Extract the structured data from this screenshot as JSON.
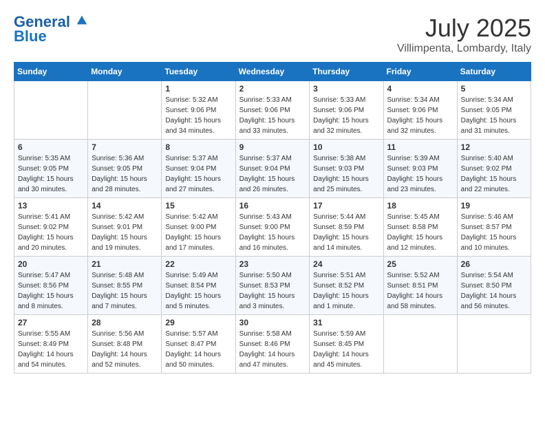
{
  "logo": {
    "line1": "General",
    "line2": "Blue"
  },
  "title": "July 2025",
  "location": "Villimpenta, Lombardy, Italy",
  "weekdays": [
    "Sunday",
    "Monday",
    "Tuesday",
    "Wednesday",
    "Thursday",
    "Friday",
    "Saturday"
  ],
  "weeks": [
    [
      {
        "day": "",
        "info": ""
      },
      {
        "day": "",
        "info": ""
      },
      {
        "day": "1",
        "info": "Sunrise: 5:32 AM\nSunset: 9:06 PM\nDaylight: 15 hours\nand 34 minutes."
      },
      {
        "day": "2",
        "info": "Sunrise: 5:33 AM\nSunset: 9:06 PM\nDaylight: 15 hours\nand 33 minutes."
      },
      {
        "day": "3",
        "info": "Sunrise: 5:33 AM\nSunset: 9:06 PM\nDaylight: 15 hours\nand 32 minutes."
      },
      {
        "day": "4",
        "info": "Sunrise: 5:34 AM\nSunset: 9:06 PM\nDaylight: 15 hours\nand 32 minutes."
      },
      {
        "day": "5",
        "info": "Sunrise: 5:34 AM\nSunset: 9:05 PM\nDaylight: 15 hours\nand 31 minutes."
      }
    ],
    [
      {
        "day": "6",
        "info": "Sunrise: 5:35 AM\nSunset: 9:05 PM\nDaylight: 15 hours\nand 30 minutes."
      },
      {
        "day": "7",
        "info": "Sunrise: 5:36 AM\nSunset: 9:05 PM\nDaylight: 15 hours\nand 28 minutes."
      },
      {
        "day": "8",
        "info": "Sunrise: 5:37 AM\nSunset: 9:04 PM\nDaylight: 15 hours\nand 27 minutes."
      },
      {
        "day": "9",
        "info": "Sunrise: 5:37 AM\nSunset: 9:04 PM\nDaylight: 15 hours\nand 26 minutes."
      },
      {
        "day": "10",
        "info": "Sunrise: 5:38 AM\nSunset: 9:03 PM\nDaylight: 15 hours\nand 25 minutes."
      },
      {
        "day": "11",
        "info": "Sunrise: 5:39 AM\nSunset: 9:03 PM\nDaylight: 15 hours\nand 23 minutes."
      },
      {
        "day": "12",
        "info": "Sunrise: 5:40 AM\nSunset: 9:02 PM\nDaylight: 15 hours\nand 22 minutes."
      }
    ],
    [
      {
        "day": "13",
        "info": "Sunrise: 5:41 AM\nSunset: 9:02 PM\nDaylight: 15 hours\nand 20 minutes."
      },
      {
        "day": "14",
        "info": "Sunrise: 5:42 AM\nSunset: 9:01 PM\nDaylight: 15 hours\nand 19 minutes."
      },
      {
        "day": "15",
        "info": "Sunrise: 5:42 AM\nSunset: 9:00 PM\nDaylight: 15 hours\nand 17 minutes."
      },
      {
        "day": "16",
        "info": "Sunrise: 5:43 AM\nSunset: 9:00 PM\nDaylight: 15 hours\nand 16 minutes."
      },
      {
        "day": "17",
        "info": "Sunrise: 5:44 AM\nSunset: 8:59 PM\nDaylight: 15 hours\nand 14 minutes."
      },
      {
        "day": "18",
        "info": "Sunrise: 5:45 AM\nSunset: 8:58 PM\nDaylight: 15 hours\nand 12 minutes."
      },
      {
        "day": "19",
        "info": "Sunrise: 5:46 AM\nSunset: 8:57 PM\nDaylight: 15 hours\nand 10 minutes."
      }
    ],
    [
      {
        "day": "20",
        "info": "Sunrise: 5:47 AM\nSunset: 8:56 PM\nDaylight: 15 hours\nand 8 minutes."
      },
      {
        "day": "21",
        "info": "Sunrise: 5:48 AM\nSunset: 8:55 PM\nDaylight: 15 hours\nand 7 minutes."
      },
      {
        "day": "22",
        "info": "Sunrise: 5:49 AM\nSunset: 8:54 PM\nDaylight: 15 hours\nand 5 minutes."
      },
      {
        "day": "23",
        "info": "Sunrise: 5:50 AM\nSunset: 8:53 PM\nDaylight: 15 hours\nand 3 minutes."
      },
      {
        "day": "24",
        "info": "Sunrise: 5:51 AM\nSunset: 8:52 PM\nDaylight: 15 hours\nand 1 minute."
      },
      {
        "day": "25",
        "info": "Sunrise: 5:52 AM\nSunset: 8:51 PM\nDaylight: 14 hours\nand 58 minutes."
      },
      {
        "day": "26",
        "info": "Sunrise: 5:54 AM\nSunset: 8:50 PM\nDaylight: 14 hours\nand 56 minutes."
      }
    ],
    [
      {
        "day": "27",
        "info": "Sunrise: 5:55 AM\nSunset: 8:49 PM\nDaylight: 14 hours\nand 54 minutes."
      },
      {
        "day": "28",
        "info": "Sunrise: 5:56 AM\nSunset: 8:48 PM\nDaylight: 14 hours\nand 52 minutes."
      },
      {
        "day": "29",
        "info": "Sunrise: 5:57 AM\nSunset: 8:47 PM\nDaylight: 14 hours\nand 50 minutes."
      },
      {
        "day": "30",
        "info": "Sunrise: 5:58 AM\nSunset: 8:46 PM\nDaylight: 14 hours\nand 47 minutes."
      },
      {
        "day": "31",
        "info": "Sunrise: 5:59 AM\nSunset: 8:45 PM\nDaylight: 14 hours\nand 45 minutes."
      },
      {
        "day": "",
        "info": ""
      },
      {
        "day": "",
        "info": ""
      }
    ]
  ]
}
